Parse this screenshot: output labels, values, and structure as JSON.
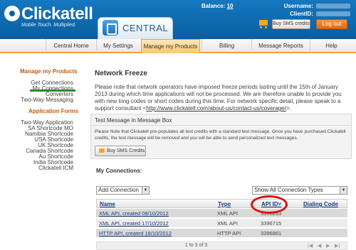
{
  "header": {
    "logo_text": "Clickatell",
    "tagline": "Mobile Touch. Multiplied.",
    "central_label": "CENTRAL",
    "balance_label": "Balance:",
    "balance_value": "10",
    "username_label": "Username:",
    "clientid_label": "ClientID:",
    "buy_sms_label": "Buy SMS credits",
    "logout_label": "Log out"
  },
  "nav": {
    "items": [
      "Central Home",
      "My Settings",
      "Manage my Products",
      "Billing",
      "Message Reports",
      "Help"
    ],
    "active": "Manage my Products"
  },
  "sidebar": {
    "section1_title": "Manage my Products",
    "section1_items": [
      "Get Connections",
      "My Connections",
      "Converters",
      "Two-Way Messaging"
    ],
    "section2_title": "Application Forms",
    "section2_items": [
      "Two-Way Application",
      "SA Shortcode MO",
      "Namibia Shortcode",
      "USA Shortcode",
      "UK Shortcode",
      "Canada Shortcode",
      "Au Shortcode",
      "India Shortcode",
      "Clickatell ICM"
    ]
  },
  "main": {
    "title": "Network Freeze",
    "notice_text": "Please note that network operators have imposed freeze periods lasting until the 15th of January 2013 during which time applications will not be processed. We are therefore unable to provide you with new long codes or short codes during this time. For network specific detail, please speak to a support consultant <",
    "notice_link": "http://www.clickatell.com/about-us/contact-us/coverage/",
    "notice_end": ">.",
    "testbox_title": "Test Message in Message Box",
    "testbox_text": "Please Note that Clickatell pre-populates all test credits with a standard test message. Once you have purchased Clickatell credits, the test message will be removed and you will be able to send personalized text messages.",
    "buy_button_label": "Buy SMS Credits",
    "my_connections_label": "My Connections:",
    "add_connection_label": "Add Connection",
    "filter_label": "Show All Connection Types"
  },
  "table": {
    "columns": [
      "Name",
      "Type",
      "API ID",
      "Dialing Code"
    ],
    "sort_indicator": "˅",
    "rows": [
      {
        "name": "XML API, created 08/10/2012",
        "type": "XML API",
        "api_id": "3396263",
        "dialing": ""
      },
      {
        "name": "XML API, created 17/10/2012",
        "type": "XML API",
        "api_id": "3396715",
        "dialing": ""
      },
      {
        "name": "HTTP API, created 18/10/2012",
        "type": "HTTP API",
        "api_id": "3396861",
        "dialing": ""
      }
    ],
    "pager_text": "1 to 3 of 3"
  },
  "colors": {
    "brand_blue": "#0a5da0",
    "accent_orange": "#f0a22e",
    "highlight_red": "#e01010"
  }
}
